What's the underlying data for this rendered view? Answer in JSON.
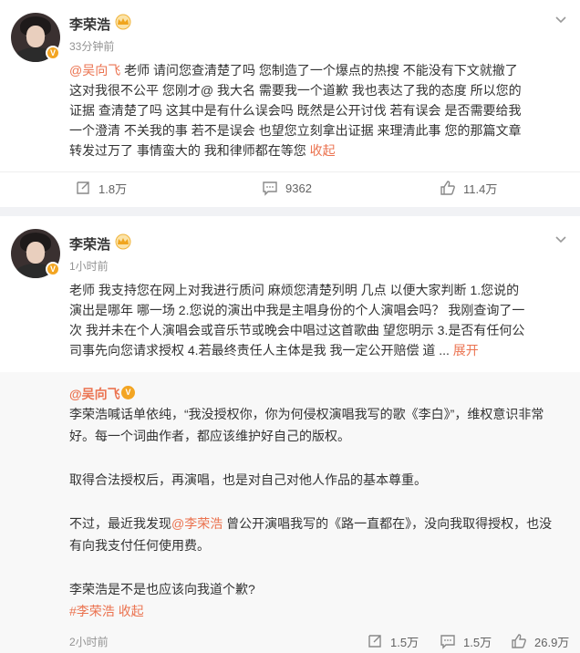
{
  "post1": {
    "author": "李荣浩",
    "time": "33分钟前",
    "mention": "@吴向飞",
    "text_lines": [
      " 老师 请问您查清楚了吗 您制造了一个爆点的热搜 不能没有下文就撤了",
      "这对我很不公平 您刚才@ 我大名 需要我一个道歉  我也表达了我的态度 所以您的",
      "证据 查清楚了吗 这其中是有什么误会吗 既然是公开讨伐 若有误会 是否需要给我",
      "一个澄清 不关我的事 若不是误会 也望您立刻拿出证据 来理清此事 您的那篇文章",
      "转发过万了 事情蛮大的 我和律师都在等您 "
    ],
    "collapse": "收起",
    "reposts": "1.8万",
    "comments": "9362",
    "likes": "11.4万"
  },
  "post2": {
    "author": "李荣浩",
    "time": "1小时前",
    "text_lines": [
      "老师 我支持您在网上对我进行质问 麻烦您清楚列明 几点  以便大家判断 1.您说的",
      "演出是哪年 哪一场  2.您说的演出中我是主唱身份的个人演唱会吗？ 我刚查询了一",
      "次 我并未在个人演唱会或音乐节或晚会中唱过这首歌曲 望您明示 3.是否有任何公",
      "司事先向您请求授权  4.若最终责任人主体是我 我一定公开赔偿 道 ... "
    ],
    "expand": "展开",
    "repost": {
      "author": "@吴向飞",
      "para1_lines": [
        "李荣浩喊话单依纯，“我没授权你，你为何侵权演唱我写的歌《李白》”，维权意识非常",
        "好。每一个词曲作者，都应该维护好自己的版权。"
      ],
      "para2": "取得合法授权后，再演唱，也是对自己对他人作品的基本尊重。",
      "para3_prefix": "不过，最近我发现",
      "para3_mention": "@李荣浩",
      "para3_suffix": " 曾公开演唱我写的《路一直都在》，没向我取得授权，也没",
      "para3_line2": "有向我支付任何使用费。",
      "para4": "李荣浩是不是也应该向我道个歉?",
      "hashtag": "#李荣浩",
      "collapse": "收起",
      "time": "2小时前",
      "reposts": "1.5万",
      "comments": "1.5万",
      "likes": "26.9万"
    }
  },
  "colors": {
    "accent": "#eb7350",
    "verified": "#f3a522",
    "gap": "#f1f2f5"
  }
}
